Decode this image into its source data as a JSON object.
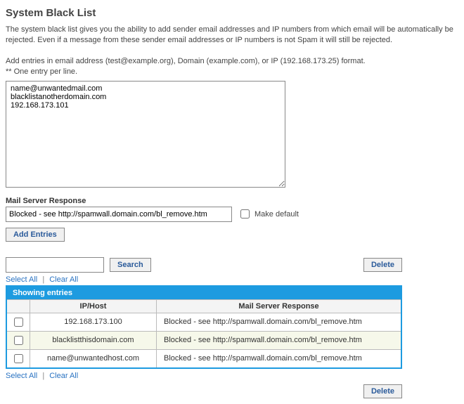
{
  "title": "System Black List",
  "description": "The system black list gives you the ability to add sender email addresses and IP numbers from which email will be automatically be rejected. Even if a message from these sender email addresses or IP numbers is not Spam it will still be rejected.",
  "hint_line1": "Add entries in email address (test@example.org), Domain (example.com), or IP (192.168.173.25) format.",
  "hint_line2": "** One entry per line.",
  "entries_textarea": "name@unwantedmail.com\nblacklistanotherdomain.com\n192.168.173.101",
  "response": {
    "label": "Mail Server Response",
    "value": "Blocked - see http://spamwall.domain.com/bl_remove.htm",
    "make_default_label": "Make default",
    "make_default_checked": false
  },
  "buttons": {
    "add_entries": "Add Entries",
    "search": "Search",
    "delete": "Delete"
  },
  "search": {
    "value": ""
  },
  "links": {
    "select_all": "Select All",
    "clear_all": "Clear All"
  },
  "table": {
    "banner": "Showing entries",
    "col_checkbox": "",
    "col_iphost": "IP/Host",
    "col_response": "Mail Server Response",
    "rows": [
      {
        "checked": false,
        "iphost": "192.168.173.100",
        "response": "Blocked - see http://spamwall.domain.com/bl_remove.htm"
      },
      {
        "checked": false,
        "iphost": "blacklistthisdomain.com",
        "response": "Blocked - see http://spamwall.domain.com/bl_remove.htm"
      },
      {
        "checked": false,
        "iphost": "name@unwantedhost.com",
        "response": "Blocked - see http://spamwall.domain.com/bl_remove.htm"
      }
    ]
  }
}
